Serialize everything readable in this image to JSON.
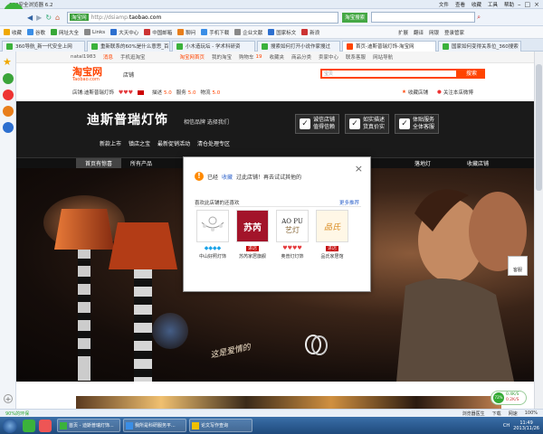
{
  "browser": {
    "title": "360安全浏览器 6.2",
    "menu": [
      "文件",
      "查看",
      "收藏",
      "工具",
      "帮助"
    ],
    "url_prefix": "http://dsiamp.",
    "url_domain": "taobao.com",
    "site_label": "淘宝网",
    "go_label": "淘宝搜索",
    "search_placeholder": "",
    "right_tools": [
      "扩展",
      "翻译",
      "网银",
      "登录管家"
    ],
    "bookmarks": [
      "收藏",
      "谷歌",
      "网址大全",
      "Links",
      "大天中心",
      "中国邮箱",
      "聊问",
      "手机下载",
      "企业文献",
      "国家标文",
      "新浪"
    ],
    "tabs": [
      {
        "label": "360导航_新一代安全上网",
        "active": false
      },
      {
        "label": "重新联系的60%是什么意思_百",
        "active": false
      },
      {
        "label": "小木造玩坛 - 学术科研资",
        "active": false
      },
      {
        "label": "搜索如何打开小说作家搜过",
        "active": false
      },
      {
        "label": "首页-迪斯普瑞灯饰-淘宝网",
        "active": true
      },
      {
        "label": "国家如何变得关系位_360搜索",
        "active": false
      }
    ],
    "sidebar_icons": [
      "star-icon",
      "chat-icon",
      "weibo-icon",
      "stop-icon",
      "globe-icon"
    ],
    "status_left": "90%的环保",
    "status_right": "100%",
    "status_items": [
      "浏览器医生",
      "下载",
      "网速"
    ]
  },
  "taobao_top": {
    "user": "natal1983",
    "msg": "消息",
    "mobile": "手机逛淘宝",
    "links": [
      "淘宝网首页",
      "我的淘宝",
      "购物车",
      "收藏夹",
      "商品分类",
      "卖家中心",
      "联系客服",
      "网站导航"
    ],
    "cart_count": "19"
  },
  "store_header": {
    "logo_cn": "淘宝网",
    "logo_en": "Taobao.com",
    "channel": "店铺",
    "search_hint": "宝贝",
    "search_button": "搜索",
    "store_name": "店铺:迪斯普瑞灯饰",
    "ratings": [
      {
        "label": "描述",
        "value": "5.0"
      },
      {
        "label": "服务",
        "value": "5.0"
      },
      {
        "label": "物流",
        "value": "5.0"
      }
    ],
    "collect": "收藏店铺",
    "follow": "关注本店微博"
  },
  "banner": {
    "brand": "迪斯普瑞灯饰",
    "slogan": "相信品牌  选择我们",
    "subnav": [
      "新款上市",
      "镇店之宝",
      "最新促销活动",
      "清仓处理专区"
    ],
    "features": [
      {
        "line1": "诚信店铺",
        "line2": "值得信赖"
      },
      {
        "line1": "如实描述",
        "line2": "货真价实"
      },
      {
        "line1": "体贴服务",
        "line2": "全体客服"
      }
    ]
  },
  "store_nav": {
    "items": [
      "首页有惊喜",
      "所有产品"
    ],
    "right_items": [
      "落地灯",
      "收藏店铺"
    ]
  },
  "modal": {
    "message_prefix": "已经",
    "message_link": "收藏",
    "message_suffix": "过此店铺！再去试试其他的",
    "close": "×",
    "section_title": "喜欢此店铺的还喜欢",
    "more": "更多推荐",
    "shops": [
      {
        "name": "中山好照灯饰",
        "rating_type": "diamond",
        "rating_count": 4,
        "mark": "none",
        "img": "chandelier"
      },
      {
        "name": "苏芮家居旗舰",
        "rating_type": "none",
        "rating_count": 0,
        "mark": "button",
        "img": "suri"
      },
      {
        "name": "奥普灯灯饰",
        "rating_type": "heart",
        "rating_count": 4,
        "mark": "none",
        "img": "aopu"
      },
      {
        "name": "品氏家居馆",
        "rating_type": "none",
        "rating_count": 0,
        "mark": "button",
        "img": "pinshi"
      }
    ],
    "shop_logos": {
      "suri": "苏芮",
      "aopu_top": "AO PU",
      "aopu_mid": "艺灯",
      "pinshi": "品氏"
    },
    "visit_button": "进店"
  },
  "hero": {
    "handwriting": "这是爱情的",
    "side_button": "客服"
  },
  "floating": {
    "speed_up": "0.4K/S",
    "speed_down": "0.2K/S",
    "percent": "72%"
  },
  "taskbar": {
    "items": [
      "首页 - 迪斯普瑞灯饰...",
      "我所是科研服务平...",
      "论文写作查询"
    ],
    "lang": "CH",
    "time": "11:49",
    "date": "2013/11/26"
  }
}
